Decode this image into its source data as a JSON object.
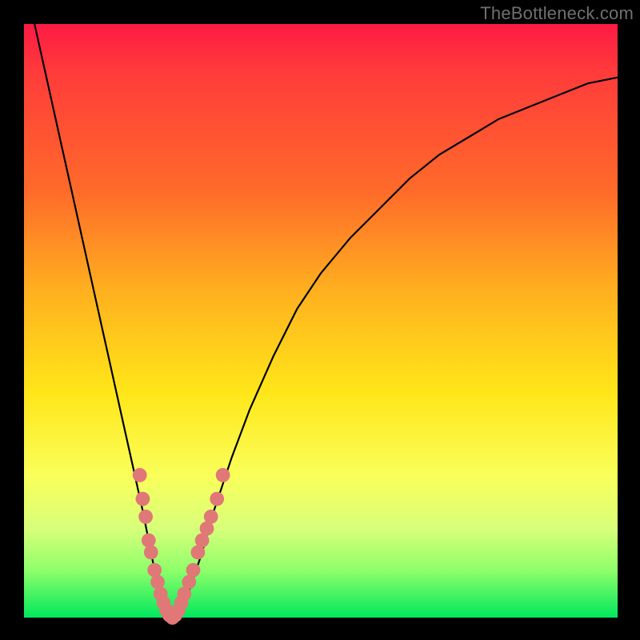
{
  "watermark": "TheBottleneck.com",
  "gradient_colors": {
    "top": "#ff1a44",
    "mid1": "#ff6a2a",
    "mid2": "#ffe619",
    "mid3": "#faff5a",
    "bottom": "#00e85c"
  },
  "chart_data": {
    "type": "line",
    "title": "",
    "xlabel": "",
    "ylabel": "",
    "xlim": [
      0,
      100
    ],
    "ylim": [
      0,
      100
    ],
    "grid": false,
    "series": [
      {
        "name": "curve",
        "x": [
          0,
          2,
          4,
          6,
          8,
          10,
          12,
          14,
          16,
          18,
          20,
          21,
          22,
          23,
          24,
          25,
          26,
          28,
          30,
          32,
          35,
          38,
          42,
          46,
          50,
          55,
          60,
          65,
          70,
          75,
          80,
          85,
          90,
          95,
          100
        ],
        "y": [
          108,
          99,
          90,
          81,
          72,
          63,
          54,
          45,
          36,
          27,
          18,
          13,
          8,
          4,
          1,
          0,
          1,
          5,
          11,
          18,
          27,
          35,
          44,
          52,
          58,
          64,
          69,
          74,
          78,
          81,
          84,
          86,
          88,
          90,
          91
        ]
      }
    ],
    "markers": {
      "name": "data-points",
      "color": "#e07878",
      "radius": 1.2,
      "points": [
        {
          "x": 19.5,
          "y": 24
        },
        {
          "x": 20.0,
          "y": 20
        },
        {
          "x": 20.5,
          "y": 17
        },
        {
          "x": 21.0,
          "y": 13
        },
        {
          "x": 21.4,
          "y": 11
        },
        {
          "x": 22.0,
          "y": 8
        },
        {
          "x": 22.5,
          "y": 6
        },
        {
          "x": 23.0,
          "y": 4
        },
        {
          "x": 23.5,
          "y": 2.5
        },
        {
          "x": 24.0,
          "y": 1.2
        },
        {
          "x": 24.5,
          "y": 0.4
        },
        {
          "x": 25.0,
          "y": 0
        },
        {
          "x": 25.5,
          "y": 0.4
        },
        {
          "x": 26.0,
          "y": 1.2
        },
        {
          "x": 26.5,
          "y": 2.5
        },
        {
          "x": 27.0,
          "y": 4
        },
        {
          "x": 27.8,
          "y": 6
        },
        {
          "x": 28.5,
          "y": 8
        },
        {
          "x": 29.3,
          "y": 11
        },
        {
          "x": 30.0,
          "y": 13
        },
        {
          "x": 30.8,
          "y": 15
        },
        {
          "x": 31.5,
          "y": 17
        },
        {
          "x": 32.5,
          "y": 20
        },
        {
          "x": 33.5,
          "y": 24
        }
      ]
    }
  }
}
